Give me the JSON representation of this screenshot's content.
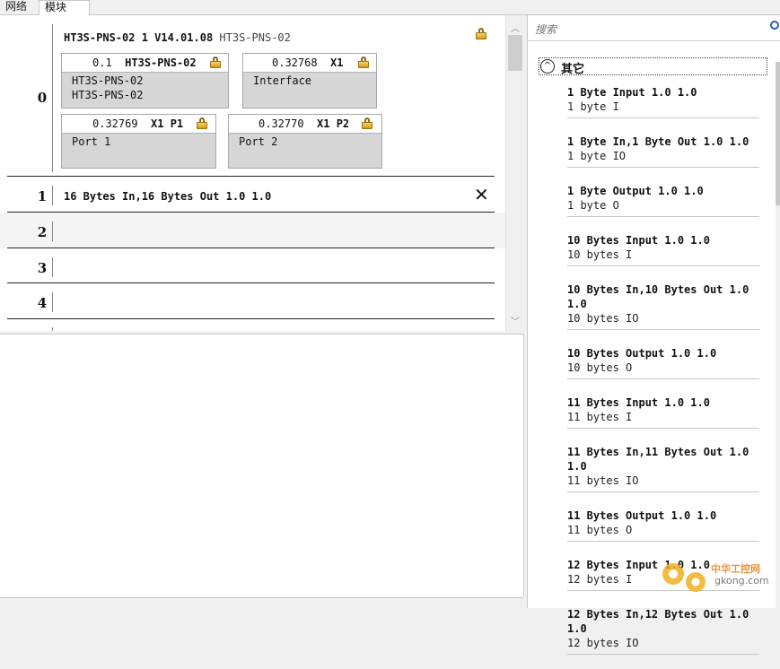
{
  "tabs": [
    {
      "label": "网络"
    },
    {
      "label": "模块"
    }
  ],
  "slots": {
    "rows": [
      {
        "num": "0"
      },
      {
        "num": "1",
        "module": "16 Bytes In,16 Bytes Out 1.0 1.0"
      },
      {
        "num": "2"
      },
      {
        "num": "3"
      },
      {
        "num": "4"
      }
    ],
    "head_module": {
      "title_bold": "HT3S-PNS-02 1 V14.01.08",
      "title_sub": "HT3S-PNS-02"
    },
    "submodules": [
      {
        "addr": "0.1",
        "name": "HT3S-PNS-02",
        "line1": "HT3S-PNS-02",
        "line2": "HT3S-PNS-02"
      },
      {
        "addr": "0.32768",
        "name": "X1",
        "line1": "Interface"
      },
      {
        "addr": "0.32769",
        "name": "X1 P1",
        "line1": "Port 1"
      },
      {
        "addr": "0.32770",
        "name": "X1 P2",
        "line1": "Port 2"
      }
    ]
  },
  "catalog": {
    "search_placeholder": "搜索",
    "group_label": "其它",
    "items": [
      {
        "name": "1 Byte Input 1.0 1.0",
        "desc": "1 byte I"
      },
      {
        "name": "1 Byte In,1 Byte Out 1.0 1.0",
        "desc": "1 byte IO"
      },
      {
        "name": "1 Byte Output 1.0 1.0",
        "desc": "1 byte O"
      },
      {
        "name": "10 Bytes Input 1.0 1.0",
        "desc": "10 bytes I"
      },
      {
        "name": "10 Bytes In,10 Bytes Out 1.0 1.0",
        "desc": "10 bytes IO"
      },
      {
        "name": "10 Bytes Output 1.0 1.0",
        "desc": "10 bytes O"
      },
      {
        "name": "11 Bytes Input 1.0 1.0",
        "desc": "11 bytes I"
      },
      {
        "name": "11 Bytes In,11 Bytes Out 1.0 1.0",
        "desc": "11 bytes IO"
      },
      {
        "name": "11 Bytes Output 1.0 1.0",
        "desc": "11 bytes O"
      },
      {
        "name": "12 Bytes Input 1.0 1.0",
        "desc": "12 bytes I"
      },
      {
        "name": "12 Bytes In,12 Bytes Out 1.0 1.0",
        "desc": "12 bytes IO"
      }
    ]
  },
  "watermark": {
    "line1": "中华工控网",
    "line2": "gkong.com"
  }
}
